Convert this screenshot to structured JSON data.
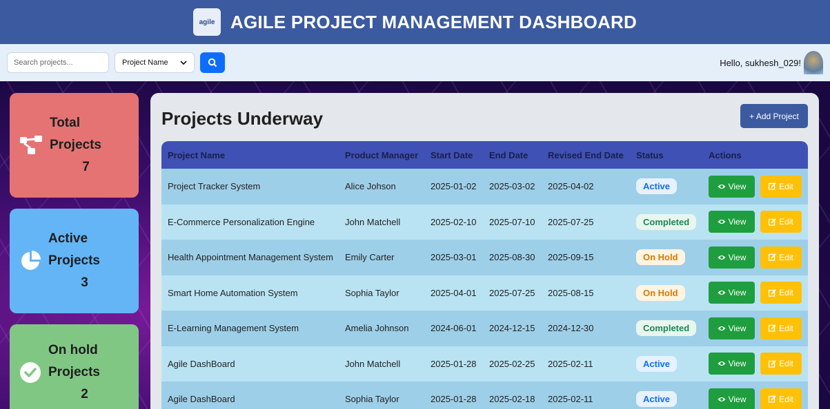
{
  "header": {
    "logo_text": "agile",
    "title": "AGILE PROJECT MANAGEMENT DASHBOARD"
  },
  "toolbar": {
    "search_placeholder": "Search projects...",
    "filter_selected": "Project Name",
    "greeting": "Hello, sukhesh_029!"
  },
  "cards": [
    {
      "label_top": "Total",
      "label_bottom": "Projects",
      "count": "7",
      "icon": "sitemap-icon",
      "color": "#e57373"
    },
    {
      "label_top": "Active",
      "label_bottom": "Projects",
      "count": "3",
      "icon": "pie-chart-icon",
      "color": "#64b5f6"
    },
    {
      "label_top": "On hold",
      "label_bottom": "Projects",
      "count": "2",
      "icon": "check-circle-icon",
      "color": "#81c784"
    }
  ],
  "panel": {
    "title": "Projects Underway",
    "add_button": "+ Add Project"
  },
  "table": {
    "headers": [
      "Project Name",
      "Product Manager",
      "Start Date",
      "End Date",
      "Revised End Date",
      "Status",
      "Actions"
    ],
    "view_label": "View",
    "edit_label": "Edit",
    "rows": [
      {
        "name": "Project Tracker System",
        "manager": "Alice Johson",
        "start": "2025-01-02",
        "end": "2025-03-02",
        "revised": "2025-04-02",
        "status": "Active"
      },
      {
        "name": "E-Commerce Personalization Engine",
        "manager": "John Matchell",
        "start": "2025-02-10",
        "end": "2025-07-10",
        "revised": "2025-07-25",
        "status": "Completed"
      },
      {
        "name": "Health Appointment Management System",
        "manager": "Emily Carter",
        "start": "2025-03-01",
        "end": "2025-08-30",
        "revised": "2025-09-15",
        "status": "On Hold"
      },
      {
        "name": "Smart Home Automation System",
        "manager": "Sophia Taylor",
        "start": "2025-04-01",
        "end": "2025-07-25",
        "revised": "2025-08-15",
        "status": "On Hold"
      },
      {
        "name": "E-Learning Management System",
        "manager": "Amelia Johnson",
        "start": "2024-06-01",
        "end": "2024-12-15",
        "revised": "2024-12-30",
        "status": "Completed"
      },
      {
        "name": "Agile DashBoard",
        "manager": "John Matchell",
        "start": "2025-01-28",
        "end": "2025-02-25",
        "revised": "2025-02-11",
        "status": "Active"
      },
      {
        "name": "Agile DashBoard",
        "manager": "Sophia Taylor",
        "start": "2025-01-28",
        "end": "2025-02-18",
        "revised": "2025-02-11",
        "status": "Active"
      }
    ]
  },
  "colors": {
    "header": "#3b5aa0",
    "primary": "#0d6efd",
    "view": "#1e9e3e",
    "edit": "#ffc107",
    "table_header": "#3f51b5"
  }
}
